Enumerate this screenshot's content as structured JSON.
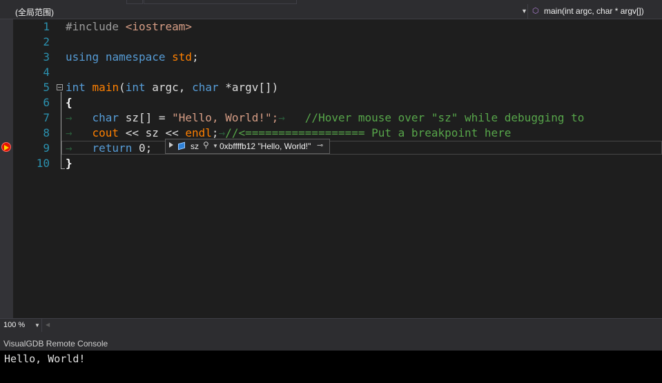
{
  "navbar": {
    "scope": "(全局范围)",
    "function": "main(int argc, char * argv[])"
  },
  "line_numbers": [
    "1",
    "2",
    "3",
    "4",
    "5",
    "6",
    "7",
    "8",
    "9",
    "10"
  ],
  "code": {
    "l1": {
      "directive": "#include",
      "header": "<iostream>"
    },
    "l3": {
      "using": "using",
      "namespace": "namespace",
      "std": "std",
      "semi": ";"
    },
    "l5": {
      "int": "int",
      "main": "main",
      "open": "(",
      "int2": "int",
      "argc": "argc",
      "comma": ",",
      "char": "char",
      "argv": "*argv[])"
    },
    "l6": {
      "brace": "{"
    },
    "l7": {
      "char": "char",
      "decl": "sz[] = ",
      "str": "\"Hello, World!\";",
      "comment": "//Hover mouse over \"sz\" while debugging to"
    },
    "l8": {
      "cout": "cout",
      "ops": " << ",
      "sz": "sz",
      "ops2": " << ",
      "endl": "endl",
      "semi": ";",
      "comment": "//<================== Put a breakpoint here"
    },
    "l9": {
      "return": "return",
      "val": " 0;"
    },
    "l10": {
      "brace": "}"
    }
  },
  "datatip": {
    "name": "sz",
    "value": "0xbffffb12 \"Hello, World!\""
  },
  "zoom": "100 %",
  "panel": {
    "title": "VisualGDB Remote Console",
    "output": "Hello, World!"
  },
  "colors": {
    "keyword": "#569cd6",
    "string": "#d69d85",
    "comment": "#57a64a",
    "function": "#ff8000",
    "breakpoint": "#e51400"
  }
}
